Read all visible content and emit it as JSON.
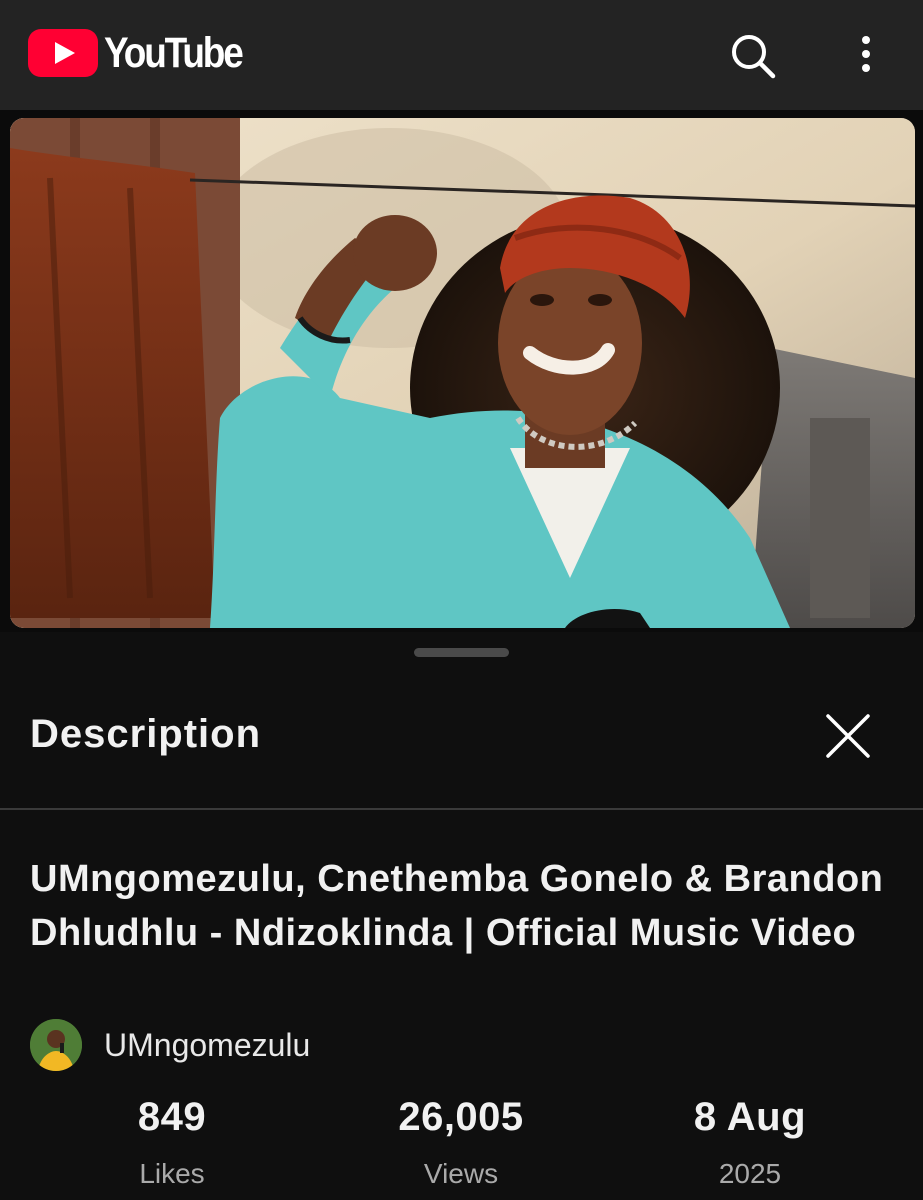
{
  "header": {
    "logo_text": "YouTube",
    "search_icon": "search-icon",
    "more_icon": "more-vertical-icon"
  },
  "sheet": {
    "title": "Description",
    "close_icon": "close-icon"
  },
  "video": {
    "title": "UMngomezulu, Cnethemba Gonelo & Brandon Dhludhlu - Ndizoklinda | Official Music Video",
    "channel_name": "UMngomezulu"
  },
  "stats": {
    "likes_value": "849",
    "likes_label": "Likes",
    "views_value": "26,005",
    "views_label": "Views",
    "date_value": "8 Aug",
    "date_label": "2025"
  },
  "colors": {
    "brand_red": "#ff0033",
    "background": "#0f0f0f",
    "appbar": "#232323"
  }
}
